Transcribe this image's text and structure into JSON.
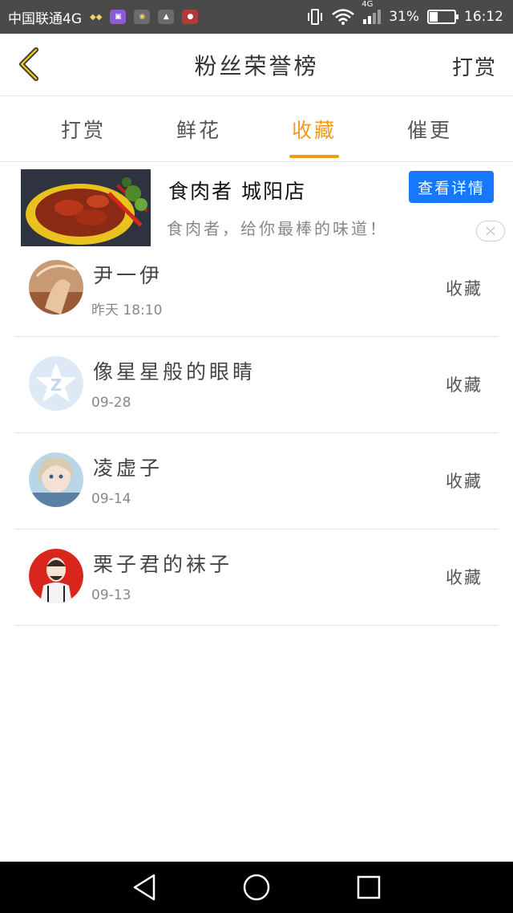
{
  "status_bar": {
    "carrier": "中国联通4G",
    "network_badge": "4G",
    "battery": "31%",
    "battery_level": 0.31,
    "time": "16:12",
    "icons": [
      "signal-icon",
      "gallery-icon",
      "owl-icon",
      "app-icon",
      "app-red-icon",
      "vibrate-icon",
      "wifi-icon",
      "battery-icon"
    ]
  },
  "header": {
    "title": "粉丝荣誉榜",
    "action_label": "打赏",
    "back_icon": "chevron-left-icon"
  },
  "tabs": [
    {
      "label": "打赏",
      "active": false
    },
    {
      "label": "鲜花",
      "active": false
    },
    {
      "label": "收藏",
      "active": true
    },
    {
      "label": "催更",
      "active": false
    }
  ],
  "ad": {
    "title": "食肉者 城阳店",
    "description": "食肉者，给你最棒的味道！",
    "button_label": "查看详情",
    "close_icon": "close-icon"
  },
  "list": [
    {
      "name": "尹一伊",
      "time": "昨天 18:10",
      "action": "收藏"
    },
    {
      "name": "像星星般的眼睛",
      "time": "09-28",
      "action": "收藏"
    },
    {
      "name": "凌虚子",
      "time": "09-14",
      "action": "收藏"
    },
    {
      "name": "栗子君的袜子",
      "time": "09-13",
      "action": "收藏"
    }
  ],
  "nav_bar": {
    "icons": [
      "back-triangle-icon",
      "home-circle-icon",
      "recents-square-icon"
    ]
  },
  "colors": {
    "accent": "#f29a1a",
    "ad_button": "#1677ff",
    "status_bar": "#4a4a4a"
  }
}
